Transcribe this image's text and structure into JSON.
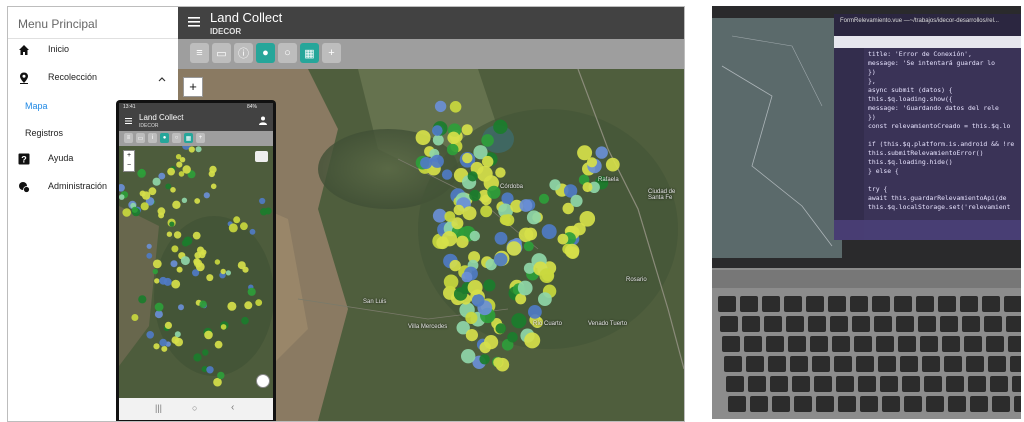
{
  "sidebar": {
    "title": "Menu Principal",
    "items": [
      {
        "label": "Inicio",
        "icon": "home-icon"
      },
      {
        "label": "Recolección",
        "icon": "map-pin-icon"
      },
      {
        "label": "Ayuda",
        "icon": "help-icon"
      },
      {
        "label": "Administración",
        "icon": "admin-gear-icon"
      }
    ],
    "subitems": [
      {
        "label": "Mapa",
        "active": true
      },
      {
        "label": "Registros",
        "active": false
      }
    ]
  },
  "header": {
    "title": "Land Collect",
    "subtitle": "IDECOR"
  },
  "toolbar": {
    "icons": [
      "list-icon",
      "comment-icon",
      "info-icon",
      "pin-icon",
      "pin-outline-icon",
      "map-icon",
      "pin-add-icon"
    ]
  },
  "map": {
    "zoom_in": "+",
    "labels": [
      "Rafaela",
      "Ciudad de Santa Fe",
      "Rosario",
      "San Luis",
      "Río Cuarto",
      "Villa Mercedes",
      "Venado Tuerto",
      "Córdoba"
    ]
  },
  "phone": {
    "status_time": "13:41",
    "status_battery": "84%",
    "title": "Land Collect",
    "subtitle": "IDECOR",
    "zoom_in": "+",
    "zoom_out": "−"
  },
  "editor": {
    "tab_title": "FormRelevamiento.vue",
    "path": "—~/trabajos/idecor-desarrollos/rel...",
    "code": [
      "title: 'Error de Conexión',",
      "message: 'Se intentará guardar lo",
      "})",
      "},",
      "async submit (datos) {",
      "this.$q.loading.show({",
      "message: 'Guardando datos del rele",
      "})",
      "const relevamientoCreado = this.$q.lo",
      "",
      "if (this.$q.platform.is.android && !re",
      "this.submitRelevamientoError()",
      "this.$q.loading.hide()",
      "} else {",
      "",
      "try {",
      "await this.guardarRelevamientoApi(de",
      "this.$q.localStorage.set('relevamient"
    ]
  },
  "colors": {
    "topbar": "#424242",
    "toolbar": "#9e9e9e",
    "accent": "#26a69a",
    "active_link": "#1e88e5"
  }
}
